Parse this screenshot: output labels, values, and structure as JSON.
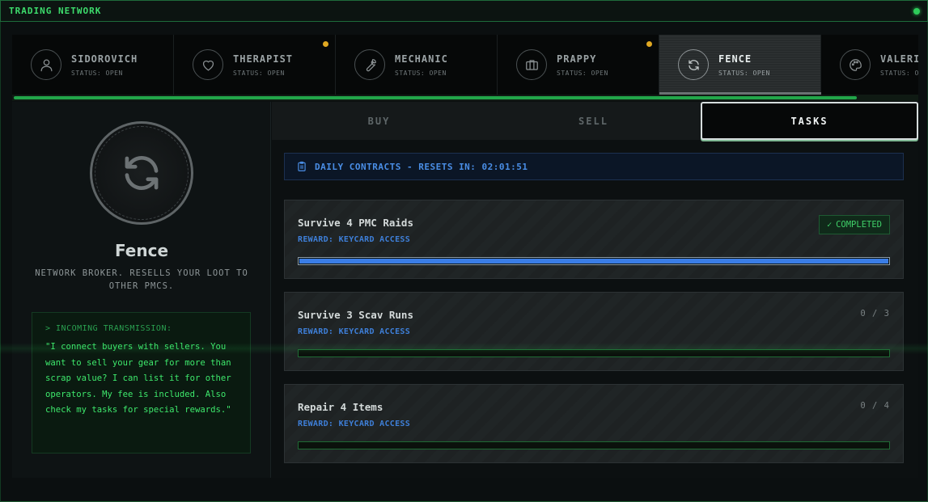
{
  "header": {
    "title": "TRADING NETWORK"
  },
  "traders": [
    {
      "name": "SIDOROVICH",
      "status": "STATUS: OPEN",
      "icon": "user-icon",
      "active": false,
      "notification": false
    },
    {
      "name": "THERAPIST",
      "status": "STATUS: OPEN",
      "icon": "heart-icon",
      "active": false,
      "notification": true
    },
    {
      "name": "MECHANIC",
      "status": "STATUS: OPEN",
      "icon": "wrench-icon",
      "active": false,
      "notification": false
    },
    {
      "name": "PRAPPY",
      "status": "STATUS: OPEN",
      "icon": "briefcase-icon",
      "active": false,
      "notification": true
    },
    {
      "name": "FENCE",
      "status": "STATUS: OPEN",
      "icon": "refresh-icon",
      "active": true,
      "notification": false
    },
    {
      "name": "VALERI",
      "status": "STATUS: OPEN",
      "icon": "palette-icon",
      "active": false,
      "notification": false
    }
  ],
  "trader_strip_progress": 0.93,
  "profile": {
    "name": "Fence",
    "description": "NETWORK BROKER. RESELLS YOUR LOOT TO OTHER PMCS.",
    "transmission_header": "> INCOMING TRANSMISSION:",
    "transmission_text": "\"I connect buyers with sellers. You want to sell your gear for more than scrap value? I can list it for other operators. My fee is included. Also check my tasks for special rewards.\""
  },
  "tabs": [
    {
      "label": "BUY",
      "active": false
    },
    {
      "label": "SELL",
      "active": false
    },
    {
      "label": "TASKS",
      "active": true
    }
  ],
  "daily": {
    "text": "DAILY CONTRACTS - RESETS IN: 02:01:51"
  },
  "tasks": [
    {
      "title": "Survive 4 PMC Raids",
      "reward": "REWARD: KEYCARD ACCESS",
      "completed": true,
      "status_label": "COMPLETED",
      "progress": 1.0
    },
    {
      "title": "Survive 3 Scav Runs",
      "reward": "REWARD: KEYCARD ACCESS",
      "completed": false,
      "count": "0 / 3",
      "progress": 0.0
    },
    {
      "title": "Repair 4 Items",
      "reward": "REWARD: KEYCARD ACCESS",
      "completed": false,
      "count": "0 / 4",
      "progress": 0.0
    }
  ],
  "colors": {
    "accent_green": "#3ddc6c",
    "accent_blue": "#3e7fd8",
    "notification": "#e0a822"
  }
}
